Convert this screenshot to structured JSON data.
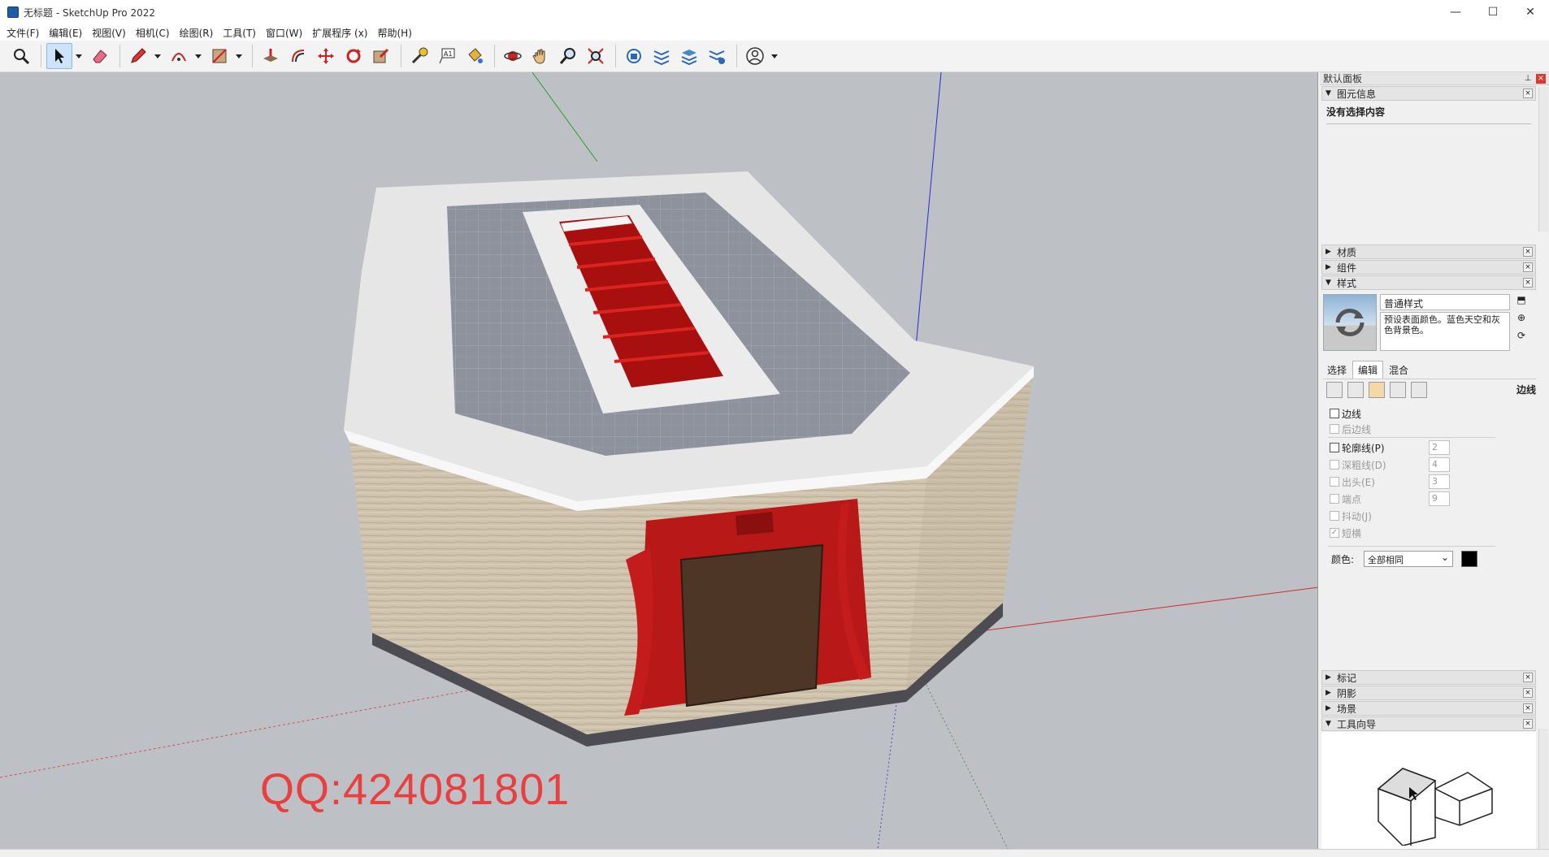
{
  "window": {
    "title": "无标题 - SketchUp Pro 2022",
    "minimize": "—",
    "maximize": "☐",
    "close": "✕"
  },
  "menu": [
    "文件(F)",
    "编辑(E)",
    "视图(V)",
    "相机(C)",
    "绘图(R)",
    "工具(T)",
    "窗口(W)",
    "扩展程序 (x)",
    "帮助(H)"
  ],
  "toolbar": {
    "active_tool": "select-tool",
    "tools": [
      "search-icon",
      "select-tool",
      "eraser-icon",
      "pencil-icon",
      "arc-icon",
      "shape-icon",
      "push-pull-icon",
      "offset-icon",
      "move-icon",
      "rotate-icon",
      "scale-icon",
      "tape-measure-icon",
      "text-icon",
      "paint-bucket-icon",
      "orbit-icon",
      "pan-icon",
      "zoom-icon",
      "zoom-extents-icon",
      "warehouse-icon",
      "extension-warehouse-icon",
      "layout-icon",
      "extension-manager-icon",
      "account-icon"
    ]
  },
  "viewport": {
    "watermark": "QQ:424081801"
  },
  "tray": {
    "title": "默认面板",
    "pin": "⊥",
    "close": "×",
    "entity_info": {
      "header": "图元信息",
      "empty": "没有选择内容"
    },
    "materials": "材质",
    "components": "组件",
    "styles": {
      "header": "样式",
      "name": "普通样式",
      "description": "预设表面颜色。蓝色天空和灰色背景色。",
      "tabs": [
        "选择",
        "编辑",
        "混合"
      ],
      "active_tab": "编辑",
      "section_title": "边线",
      "checks": [
        {
          "label": "边线",
          "checked": false,
          "enabled": true
        },
        {
          "label": "后边线",
          "checked": false,
          "enabled": false
        },
        {
          "label": "轮廓线(P)",
          "checked": false,
          "enabled": true,
          "value": "2"
        },
        {
          "label": "深粗线(D)",
          "checked": false,
          "enabled": false,
          "value": "4"
        },
        {
          "label": "出头(E)",
          "checked": false,
          "enabled": false,
          "value": "3"
        },
        {
          "label": "端点",
          "checked": false,
          "enabled": false,
          "value": "9"
        },
        {
          "label": "抖动(J)",
          "checked": false,
          "enabled": false
        },
        {
          "label": "短横",
          "checked": true,
          "enabled": false
        }
      ],
      "color_label": "颜色:",
      "color_value": "全部相同",
      "color_swatch": "#000000"
    },
    "tags": "标记",
    "shadows": "阴影",
    "scenes": "场景",
    "instructor": "工具向导"
  },
  "colors": {
    "viewport_bg": "#bdc0c5",
    "roof": "#e7e7e7",
    "wall": "#cfc3ae",
    "red": "#b81818",
    "door": "#4d3626",
    "watermark": "#e84040"
  }
}
